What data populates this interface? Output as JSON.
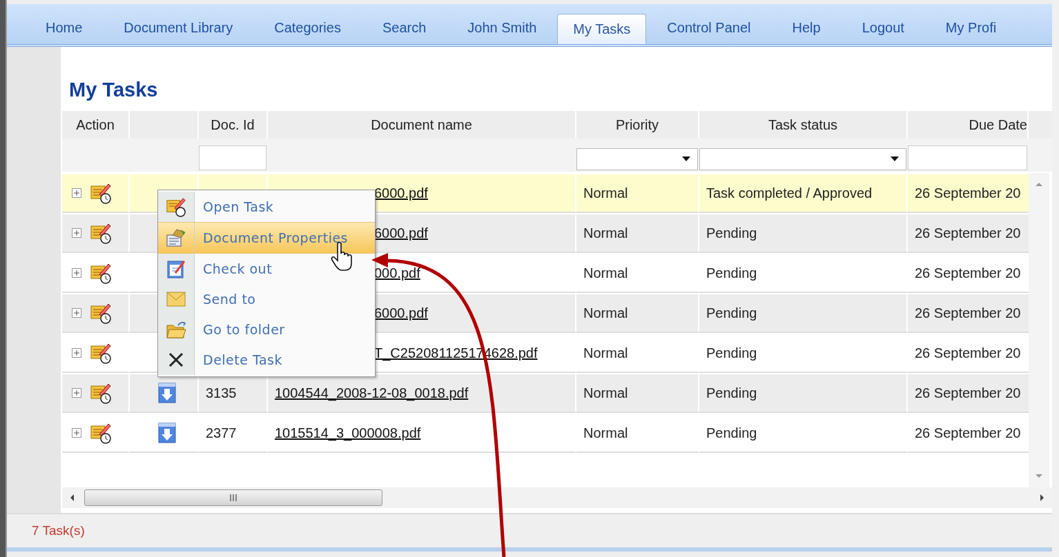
{
  "tabs": [
    {
      "label": "Home",
      "selected": false
    },
    {
      "label": "Document Library",
      "selected": false
    },
    {
      "label": "Categories",
      "selected": false
    },
    {
      "label": "Search",
      "selected": false
    },
    {
      "label": "John Smith",
      "selected": false
    },
    {
      "label": "My Tasks",
      "selected": true
    },
    {
      "label": "Control Panel",
      "selected": false
    },
    {
      "label": "Help",
      "selected": false
    },
    {
      "label": "Logout",
      "selected": false
    },
    {
      "label": "My Profi",
      "selected": false
    }
  ],
  "page_title": "My Tasks",
  "table": {
    "columns": [
      "Action",
      "Doc. Id",
      "Document name",
      "Priority",
      "Task status",
      "Due Date"
    ],
    "rows": [
      {
        "selected": true,
        "partly_hidden": true,
        "document_name": "6000.pdf",
        "priority": "Normal",
        "task_status": "Task completed / Approved",
        "due_date": "26 September 20"
      },
      {
        "selected": false,
        "partly_hidden": true,
        "document_name": "6000.pdf",
        "priority": "Normal",
        "task_status": "Pending",
        "due_date": "26 September 20"
      },
      {
        "selected": false,
        "partly_hidden": true,
        "document_name": "000.pdf",
        "priority": "Normal",
        "task_status": "Pending",
        "due_date": "26 September 20"
      },
      {
        "selected": false,
        "partly_hidden": true,
        "document_name": "6000.pdf",
        "priority": "Normal",
        "task_status": "Pending",
        "due_date": "26 September 20"
      },
      {
        "selected": false,
        "partly_hidden": true,
        "document_name": "T_C252081125174628.pdf",
        "priority": "Normal",
        "task_status": "Pending",
        "due_date": "26 September 20"
      },
      {
        "selected": false,
        "partly_hidden": false,
        "doc_id": "3135",
        "document_name": "1004544_2008-12-08_0018.pdf",
        "priority": "Normal",
        "task_status": "Pending",
        "due_date": "26 September 20"
      },
      {
        "selected": false,
        "partly_hidden": false,
        "doc_id": "2377",
        "document_name": "1015514_3_000008.pdf",
        "priority": "Normal",
        "task_status": "Pending",
        "due_date": "26 September 20"
      }
    ]
  },
  "context_menu": {
    "items": [
      {
        "kind": "task",
        "label": "Open Task",
        "selected": false
      },
      {
        "kind": "properties",
        "label": "Document Properties",
        "selected": true
      },
      {
        "kind": "checkout",
        "label": "Check out",
        "selected": false
      },
      {
        "kind": "mail",
        "label": "Send to",
        "selected": false
      },
      {
        "kind": "folder",
        "label": "Go to folder",
        "selected": false
      },
      {
        "kind": "delete",
        "label": "Delete Task",
        "selected": false
      }
    ]
  },
  "status_bar": "7 Task(s)"
}
